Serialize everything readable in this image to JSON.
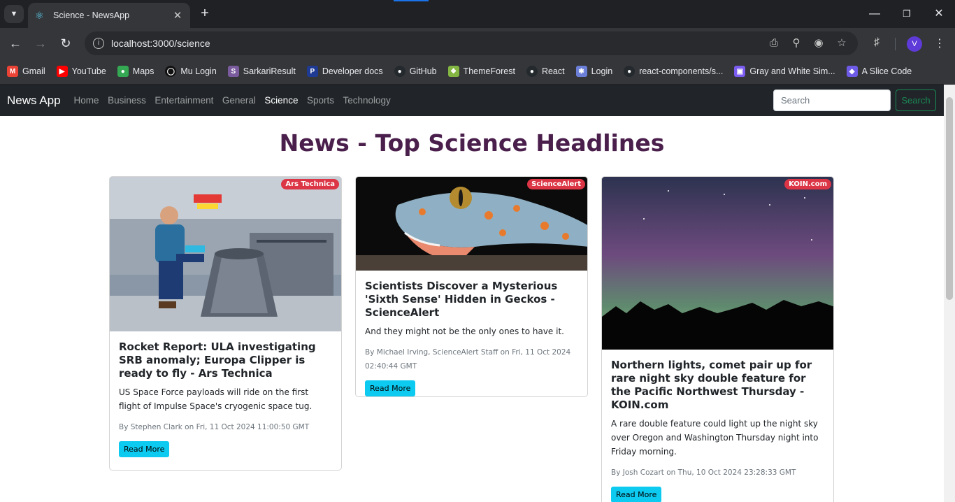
{
  "browser": {
    "tab_title": "Science - NewsApp",
    "url": "localhost:3000/science",
    "profile_initial": "V",
    "bookmarks": [
      {
        "label": "Gmail",
        "icon": "gmail-icon",
        "color": "#ea4335"
      },
      {
        "label": "YouTube",
        "icon": "youtube-icon",
        "color": "#ff0000"
      },
      {
        "label": "Maps",
        "icon": "maps-icon",
        "color": "#34a853"
      },
      {
        "label": "Mu Login",
        "icon": "mu-icon",
        "color": "#111111"
      },
      {
        "label": "SarkariResult",
        "icon": "sarkari-icon",
        "color": "#7a5c9e"
      },
      {
        "label": "Developer docs",
        "icon": "paypal-icon",
        "color": "#1f3a93"
      },
      {
        "label": "GitHub",
        "icon": "github-icon",
        "color": "#24292e"
      },
      {
        "label": "ThemeForest",
        "icon": "themeforest-icon",
        "color": "#82b541"
      },
      {
        "label": "React",
        "icon": "github-icon",
        "color": "#24292e"
      },
      {
        "label": "Login",
        "icon": "login-icon",
        "color": "#6c7fd8"
      },
      {
        "label": "react-components/s...",
        "icon": "github-icon",
        "color": "#24292e"
      },
      {
        "label": "Gray and White Sim...",
        "icon": "canva-icon",
        "color": "#7b5cf0"
      },
      {
        "label": "A Slice Code",
        "icon": "slice-icon",
        "color": "#6d5ae6"
      }
    ]
  },
  "navbar": {
    "brand": "News App",
    "links": [
      "Home",
      "Business",
      "Entertainment",
      "General",
      "Science",
      "Sports",
      "Technology"
    ],
    "active": "Science",
    "search_placeholder": "Search",
    "search_button": "Search"
  },
  "heading": "News - Top Science Headlines",
  "articles": [
    {
      "source": "Ars Technica",
      "title": "Rocket Report: ULA investigating SRB anomaly; Europa Clipper is ready to fly - Ars Technica",
      "description": "US Space Force payloads will ride on the first flight of Impulse Space's cryogenic space tug.",
      "meta": "By Stephen Clark on Fri, 11 Oct 2024 11:00:50 GMT",
      "button": "Read More"
    },
    {
      "source": "ScienceAlert",
      "title": "Scientists Discover a Mysterious 'Sixth Sense' Hidden in Geckos - ScienceAlert",
      "description": "And they might not be the only ones to have it.",
      "meta": "By Michael Irving, ScienceAlert Staff on Fri, 11 Oct 2024 02:40:44 GMT",
      "button": "Read More"
    },
    {
      "source": "KOIN.com",
      "title": "Northern lights, comet pair up for rare night sky double feature for the Pacific Northwest Thursday - KOIN.com",
      "description": "A rare double feature could light up the night sky over Oregon and Washington Thursday night into Friday morning.",
      "meta": "By Josh Cozart on Thu, 10 Oct 2024 23:28:33 GMT",
      "button": "Read More"
    }
  ],
  "colors": {
    "heading": "#4a1f4c",
    "badge": "#dc3545",
    "read_button": "#0dcaf0",
    "search_button": "#198754",
    "navbar_bg": "#212529"
  }
}
